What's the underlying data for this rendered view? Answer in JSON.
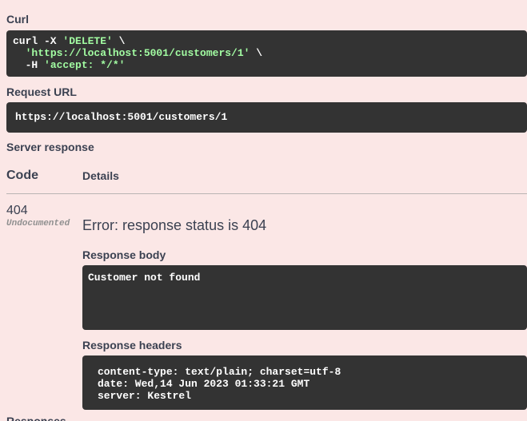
{
  "curl": {
    "label": "Curl",
    "line1_cmd": "curl -X ",
    "line1_method": "'DELETE'",
    "line1_end": " \\",
    "line2_indent": "  ",
    "line2_url": "'https://localhost:5001/customers/1'",
    "line2_end": " \\",
    "line3_flag": "  -H ",
    "line3_header": "'accept: */*'"
  },
  "request_url": {
    "label": "Request URL",
    "value": "https://localhost:5001/customers/1"
  },
  "server_response": {
    "label": "Server response",
    "code_header": "Code",
    "details_header": "Details",
    "code": "404",
    "code_note": "Undocumented",
    "error": "Error: response status is 404",
    "body_label": "Response body",
    "body": "Customer not found",
    "headers_label": "Response headers",
    "headers": [
      "content-type: text/plain; charset=utf-8",
      "date: Wed,14 Jun 2023 01:33:21 GMT",
      "server: Kestrel"
    ]
  },
  "next_section_label": "Responses",
  "colors": {
    "background": "#fbe7e6",
    "code_bg": "#333333",
    "string": "#a2fca2",
    "text": "#3b4151"
  }
}
